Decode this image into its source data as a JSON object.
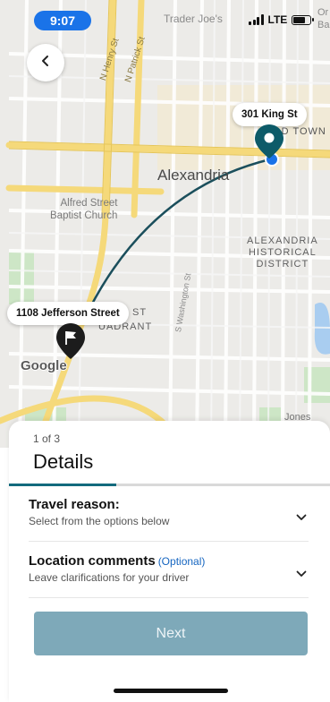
{
  "status_bar": {
    "time": "9:07",
    "network": "LTE",
    "battery_level": 0.7
  },
  "map": {
    "labels": {
      "city": "Alexandria",
      "old_town": "OLD TOWN",
      "trader_joes": "Trader Joe's",
      "ba": "Or\nBa",
      "alfred": "Alfred Street\nBaptist Church",
      "historical_district": "ALEXANDRIA\nHISTORICAL\nDISTRICT",
      "st": "ST",
      "quadrant": "UADRANT",
      "jones": "Jones",
      "n_henry": "N Henry St",
      "n_patrick": "N Patrick St",
      "s_washington": "S Washington St"
    },
    "attribution": "Google",
    "destination": {
      "label": "301 King St",
      "icon": "location-pin-icon"
    },
    "origin": {
      "label": "1108 Jefferson Street",
      "icon": "flag-pin-icon"
    },
    "colors": {
      "route": "#1b4f5c",
      "pin": "#0d5b69",
      "current_location": "#1a73e8",
      "major_road": "#f5d97a"
    }
  },
  "back_button": {
    "icon": "chevron-left-icon"
  },
  "sheet": {
    "step": "1 of 3",
    "title": "Details",
    "progress": 0.333,
    "progress_color": "#136a7d",
    "rows": [
      {
        "title": "Travel reason:",
        "subtitle": "Select from the options below",
        "icon": "chevron-down-icon"
      },
      {
        "title": "Location comments",
        "optional": "(Optional)",
        "subtitle": "Leave clarifications for your driver",
        "icon": "chevron-down-icon"
      }
    ],
    "next_label": "Next",
    "next_color": "#7ea9b9"
  }
}
